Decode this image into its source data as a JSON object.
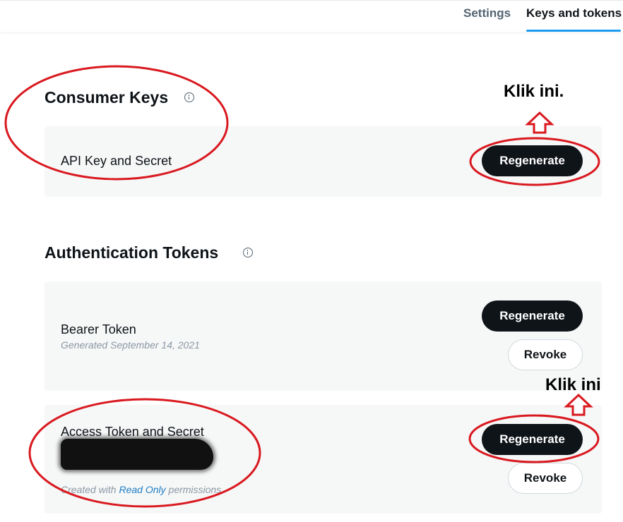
{
  "tabs": {
    "settings": "Settings",
    "keys_and_tokens": "Keys and tokens"
  },
  "consumer_keys": {
    "title": "Consumer Keys",
    "api_key_label": "API Key and Secret",
    "regenerate_label": "Regenerate"
  },
  "auth_tokens": {
    "title": "Authentication Tokens",
    "bearer": {
      "label": "Bearer Token",
      "generated": "Generated September 14, 2021",
      "regenerate_label": "Regenerate",
      "revoke_label": "Revoke"
    },
    "access": {
      "label": "Access Token and Secret",
      "created_prefix": "Created with",
      "created_link": "Read Only",
      "created_suffix": "permissions",
      "regenerate_label": "Regenerate",
      "revoke_label": "Revoke"
    }
  },
  "annotations": {
    "note_top": "Klik ini.",
    "note_bottom": "Klik ini"
  },
  "colors": {
    "accent": "#1d9bf0",
    "button_dark": "#0f1419",
    "card_bg": "#f6f7f7",
    "annotation_red": "#d9191f"
  },
  "icons": [
    "info-icon",
    "up-arrow-icon"
  ]
}
